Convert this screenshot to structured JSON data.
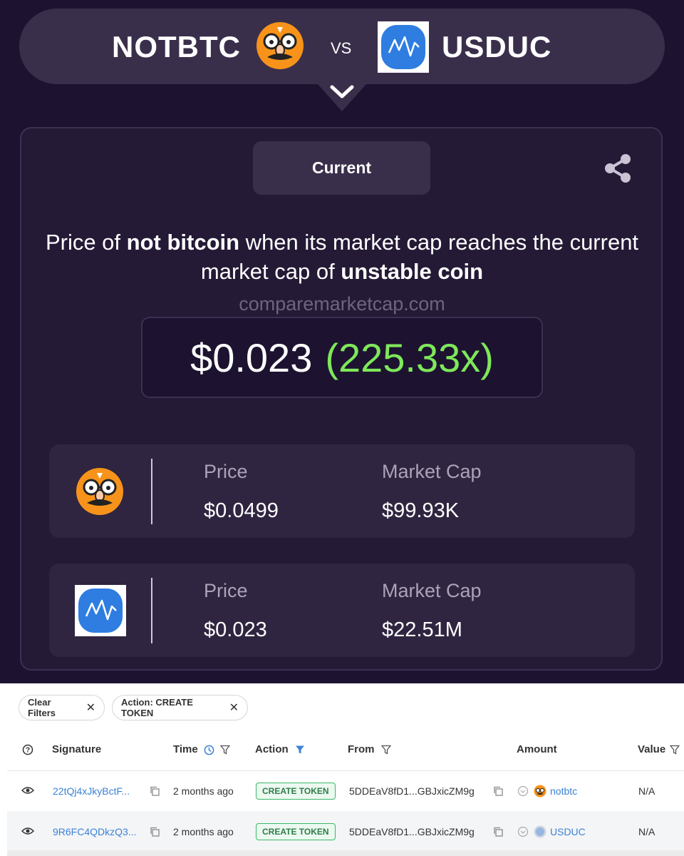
{
  "compare": {
    "left_coin": "NOTBTC",
    "right_coin": "USDUC",
    "vs_label": "VS"
  },
  "card": {
    "tab_label": "Current",
    "desc": {
      "part1": "Price of ",
      "coin_a": "not bitcoin",
      "part2": " when its market cap reaches the current market cap of ",
      "coin_b": "unstable coin"
    },
    "site": "comparemarketcap.com",
    "result_price": "$0.023",
    "result_multiplier": "(225.33x)",
    "rows": [
      {
        "price_label": "Price",
        "price": "$0.0499",
        "mcap_label": "Market Cap",
        "mcap": "$99.93K"
      },
      {
        "price_label": "Price",
        "price": "$0.023",
        "mcap_label": "Market Cap",
        "mcap": "$22.51M"
      }
    ]
  },
  "filters": [
    {
      "label": "Clear Filters"
    },
    {
      "label": "Action: CREATE TOKEN"
    }
  ],
  "table": {
    "headers": {
      "signature": "Signature",
      "time": "Time",
      "action": "Action",
      "from": "From",
      "amount": "Amount",
      "value": "Value"
    },
    "rows": [
      {
        "signature": "22tQj4xJkyBctF...",
        "time": "2 months ago",
        "action": "CREATE TOKEN",
        "from": "5DDEaV8fD1...GBJxicZM9g",
        "amount": "notbtc",
        "value": "N/A"
      },
      {
        "signature": "9R6FC4QDkzQ3...",
        "time": "2 months ago",
        "action": "CREATE TOKEN",
        "from": "5DDEaV8fD1...GBJxicZM9g",
        "amount": "USDUC",
        "value": "N/A"
      }
    ]
  },
  "colors": {
    "background": "#1d1330",
    "accent_green": "#7ee85a",
    "link_blue": "#3b82d6",
    "notbtc_orange": "#f7931a",
    "usduc_blue": "#2f7de0"
  }
}
